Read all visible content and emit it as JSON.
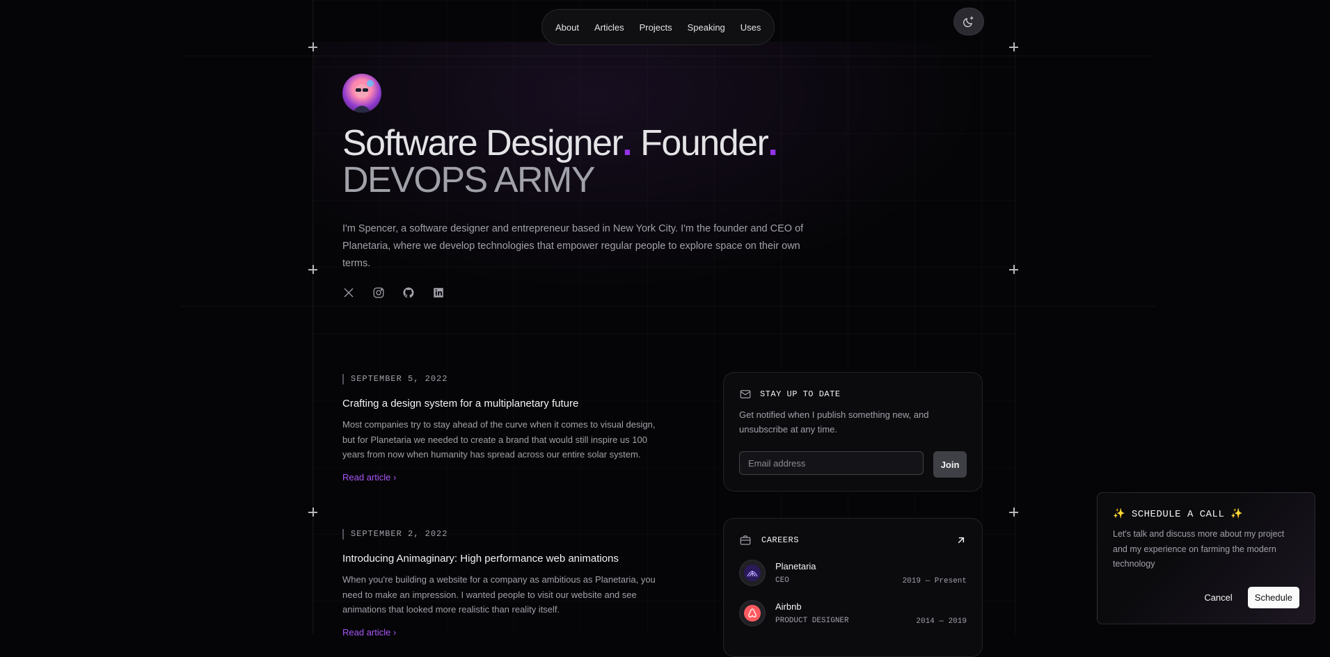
{
  "nav": {
    "items": [
      "About",
      "Articles",
      "Projects",
      "Speaking",
      "Uses"
    ]
  },
  "theme_toggle": {
    "icon": "moon-sparkle-icon"
  },
  "hero": {
    "title_part1": "Software Designer",
    "title_part2": "Founder",
    "dot": ".",
    "subtitle": "DEVOPS ARMY",
    "bio": "I'm Spencer, a software designer and entrepreneur based in New York City. I'm the founder and CEO of Planetaria, where we develop technologies that empower regular people to explore space on their own terms.",
    "socials": [
      "x-icon",
      "instagram-icon",
      "github-icon",
      "linkedin-icon"
    ],
    "accent_color": "#9333ea"
  },
  "articles": [
    {
      "date": "SEPTEMBER 5, 2022",
      "title": "Crafting a design system for a multiplanetary future",
      "description": "Most companies try to stay ahead of the curve when it comes to visual design, but for Planetaria we needed to create a brand that would still inspire us 100 years from now when humanity has spread across our entire solar system.",
      "link": "Read article"
    },
    {
      "date": "SEPTEMBER 2, 2022",
      "title": "Introducing Animaginary: High performance web animations",
      "description": "When you're building a website for a company as ambitious as Planetaria, you need to make an impression. I wanted people to visit our website and see animations that looked more realistic than reality itself.",
      "link": "Read article"
    }
  ],
  "newsletter": {
    "title": "STAY UP TO DATE",
    "text": "Get notified when I publish something new, and unsubscribe at any time.",
    "placeholder": "Email address",
    "button": "Join"
  },
  "careers": {
    "title": "CAREERS",
    "jobs": [
      {
        "company": "Planetaria",
        "role": "CEO",
        "dates": "2019 — Present"
      },
      {
        "company": "Airbnb",
        "role": "PRODUCT DESIGNER",
        "dates": "2014 — 2019"
      }
    ]
  },
  "schedule_popup": {
    "title": "✨ SCHEDULE A CALL ✨",
    "text": "Let's talk and discuss more about my project and my experience on farming the modern technology",
    "cancel": "Cancel",
    "confirm": "Schedule"
  }
}
